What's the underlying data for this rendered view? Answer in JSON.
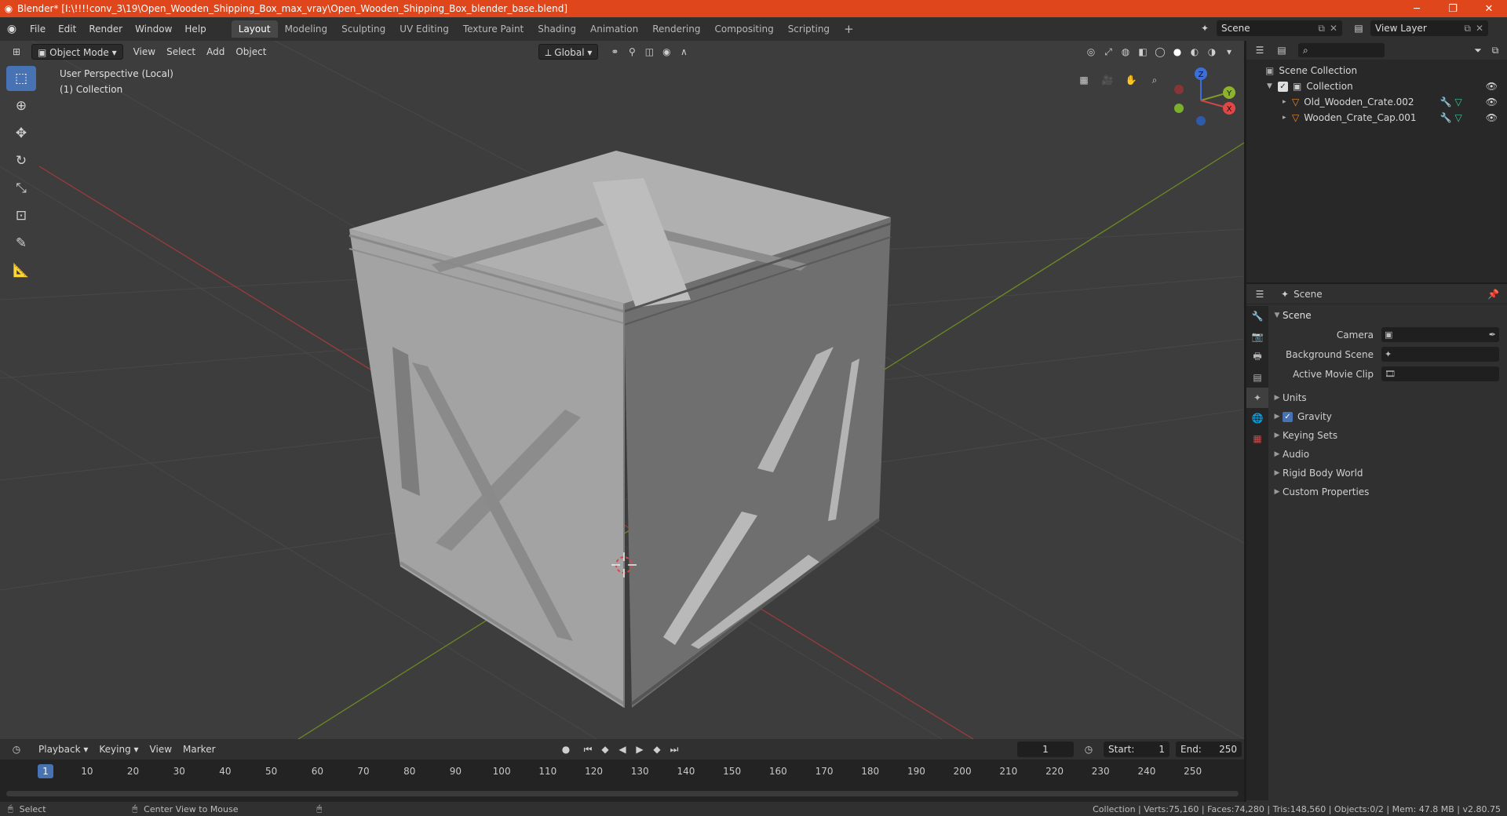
{
  "window": {
    "title": "Blender* [I:\\!!!!conv_3\\19\\Open_Wooden_Shipping_Box_max_vray\\Open_Wooden_Shipping_Box_blender_base.blend]",
    "minimize": "─",
    "maximize": "❐",
    "close": "✕"
  },
  "menu": [
    "File",
    "Edit",
    "Render",
    "Window",
    "Help"
  ],
  "workspaces": [
    "Layout",
    "Modeling",
    "Sculpting",
    "UV Editing",
    "Texture Paint",
    "Shading",
    "Animation",
    "Rendering",
    "Compositing",
    "Scripting"
  ],
  "workspace_add": "+",
  "scene_selector": {
    "scene": "Scene",
    "view_layer": "View Layer"
  },
  "viewport": {
    "mode": "Object Mode",
    "menus": [
      "View",
      "Select",
      "Add",
      "Object"
    ],
    "orientation": "Global",
    "info_line1": "User Perspective (Local)",
    "info_line2": "(1) Collection",
    "axis_labels": {
      "x": "X",
      "y": "Y",
      "z": "Z"
    }
  },
  "timeline": {
    "menus": [
      "Playback",
      "Keying",
      "View",
      "Marker"
    ],
    "current_frame": "1",
    "start_label": "Start:",
    "start": "1",
    "end_label": "End:",
    "end": "250",
    "ticks": [
      "10",
      "20",
      "30",
      "40",
      "50",
      "60",
      "70",
      "80",
      "90",
      "100",
      "110",
      "120",
      "130",
      "140",
      "150",
      "160",
      "170",
      "180",
      "190",
      "200",
      "210",
      "220",
      "230",
      "240",
      "250"
    ],
    "current_marker": "1"
  },
  "status": {
    "select": "Select",
    "center_view": "Center View to Mouse",
    "info": "Collection | Verts:75,160 | Faces:74,280 | Tris:148,560 | Objects:0/2 | Mem: 47.8 MB | v2.80.75"
  },
  "outliner": {
    "root": "Scene Collection",
    "collection": "Collection",
    "objects": [
      "Old_Wooden_Crate.002",
      "Wooden_Crate_Cap.001"
    ]
  },
  "properties": {
    "context": "Scene",
    "panel": "Scene",
    "rows": [
      {
        "label": "Camera"
      },
      {
        "label": "Background Scene"
      },
      {
        "label": "Active Movie Clip"
      }
    ],
    "subpanels": [
      "Units",
      "Gravity",
      "Keying Sets",
      "Audio",
      "Rigid Body World",
      "Custom Properties"
    ]
  },
  "colors": {
    "titlebar": "#e0461b",
    "accent": "#4772b3",
    "x_axis": "#b83a3a",
    "y_axis": "#7a9a2a",
    "crate_light": "#a9a9a9",
    "crate_dark": "#6e6e6e"
  }
}
